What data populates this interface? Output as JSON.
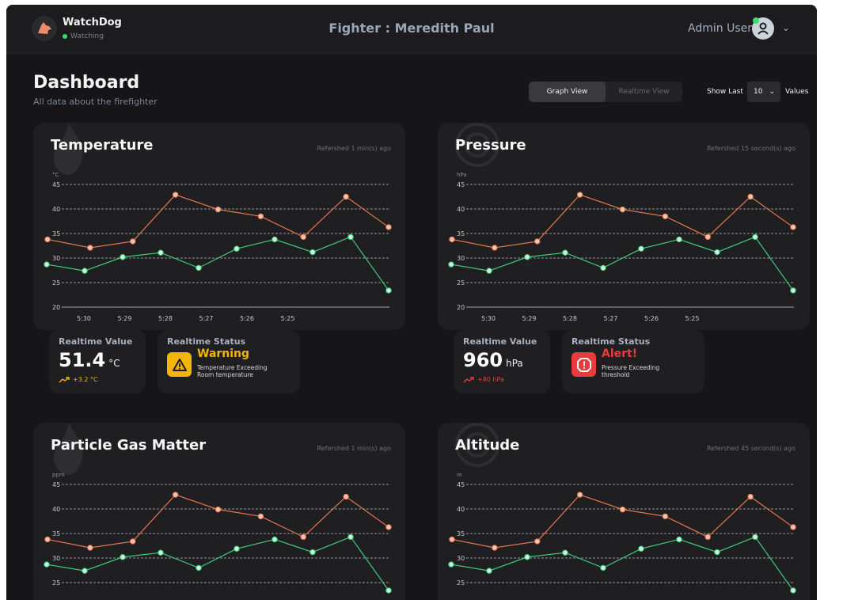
{
  "app": {
    "brand": "WatchDog",
    "status": "Watching"
  },
  "header": {
    "title": "Fighter : Meredith Paul",
    "user": "Admin User"
  },
  "page": {
    "title": "Dashboard",
    "subtitle": "All data about the firefighter"
  },
  "controls": {
    "graph_view": "Graph View",
    "realtime_view": "Realtime View",
    "show_last_label": "Show Last",
    "show_last_value": "10",
    "values_label": "Values"
  },
  "colors": {
    "high_series": "#e8764f",
    "low_series": "#3fcf7f",
    "warning": "#f5b40a",
    "alert": "#e93b3b",
    "background": "#161618",
    "card": "#1f1f21"
  },
  "cards": [
    {
      "title": "Temperature",
      "refresh": "Refershed 1 min(s) ago",
      "unit": "°C",
      "icon": "flame-icon"
    },
    {
      "title": "Pressure",
      "refresh": "Refershed 15 second(s) ago",
      "unit": "hPa",
      "icon": "gauge-icon"
    },
    {
      "title": "Particle Gas Matter",
      "refresh": "Refershed 1 min(s) ago",
      "unit": "ppm",
      "icon": "flame-icon"
    },
    {
      "title": "Altitude",
      "refresh": "Refershed 45 second(s) ago",
      "unit": "m",
      "icon": "gauge-icon"
    }
  ],
  "realtime": [
    {
      "value_label": "Realtime Value",
      "value": "51.4",
      "unit": "°C",
      "delta": "+3.2 °C",
      "status_label": "Realtime Status",
      "status": "Warning",
      "status_desc_1": "Temperature Exceeding",
      "status_desc_2": "Room temperature"
    },
    {
      "value_label": "Realtime Value",
      "value": "960",
      "unit": "hPa",
      "delta": "+80 hPa",
      "status_label": "Realtime Status",
      "status": "Alert!",
      "status_desc_1": "Pressure Exceeding",
      "status_desc_2": "threshold"
    }
  ],
  "chart_data": [
    {
      "type": "line",
      "x": [
        "5:30",
        "5:29",
        "5:28",
        "5:27",
        "5:26",
        "5:25"
      ],
      "yticks": [
        45,
        40,
        35,
        30,
        25,
        20
      ],
      "ylim": [
        20,
        45
      ],
      "ylabel": "°C",
      "grid": true,
      "series": [
        {
          "values": [
            33.8,
            32.1,
            33.4,
            42.9,
            39.9,
            38.5,
            34.3,
            42.5,
            36.3
          ]
        },
        {
          "values": [
            28.7,
            27.4,
            30.2,
            31.1,
            28.0,
            31.9,
            33.8,
            31.2,
            34.3,
            23.4
          ]
        }
      ]
    },
    {
      "type": "line",
      "x": [
        "5:30",
        "5:29",
        "5:28",
        "5:27",
        "5:26",
        "5:25"
      ],
      "yticks": [
        45,
        40,
        35,
        30,
        25,
        20
      ],
      "ylim": [
        20,
        45
      ],
      "ylabel": "hPa",
      "grid": true,
      "series": [
        {
          "values": [
            33.8,
            32.1,
            33.4,
            42.9,
            39.9,
            38.5,
            34.3,
            42.5,
            36.3
          ]
        },
        {
          "values": [
            28.7,
            27.4,
            30.2,
            31.1,
            28.0,
            31.9,
            33.8,
            31.2,
            34.3,
            23.4
          ]
        }
      ]
    },
    {
      "type": "line",
      "yticks": [
        45,
        40,
        35,
        30,
        25
      ],
      "ylim": [
        20,
        45
      ],
      "ylabel": "ppm",
      "grid": true,
      "series": [
        {
          "values": [
            33.8,
            32.1,
            33.4,
            42.9,
            39.9,
            38.5,
            34.3,
            42.5,
            36.3
          ]
        },
        {
          "values": [
            28.7,
            27.4,
            30.2,
            31.1,
            28.0,
            31.9,
            33.8,
            31.2,
            34.3,
            23.4
          ]
        }
      ]
    },
    {
      "type": "line",
      "yticks": [
        45,
        40,
        35,
        30,
        25
      ],
      "ylim": [
        20,
        45
      ],
      "ylabel": "m",
      "grid": true,
      "series": [
        {
          "values": [
            33.8,
            32.1,
            33.4,
            42.9,
            39.9,
            38.5,
            34.3,
            42.5,
            36.3
          ]
        },
        {
          "values": [
            28.7,
            27.4,
            30.2,
            31.1,
            28.0,
            31.9,
            33.8,
            31.2,
            34.3,
            23.4
          ]
        }
      ]
    }
  ]
}
